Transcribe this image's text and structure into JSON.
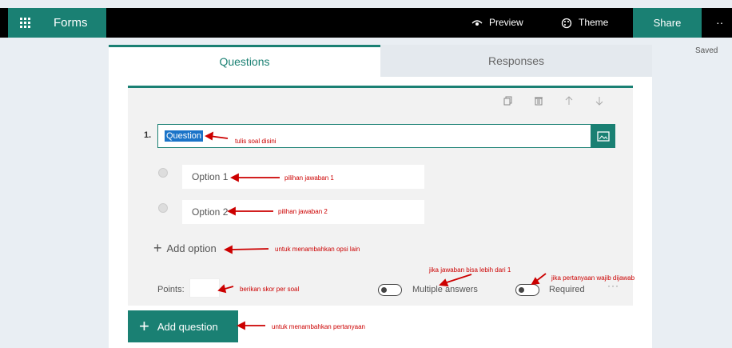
{
  "header": {
    "app_name": "Forms",
    "preview_label": "Preview",
    "theme_label": "Theme",
    "share_label": "Share",
    "more_label": "··"
  },
  "status": {
    "saved": "Saved"
  },
  "tabs": [
    {
      "label": "Questions",
      "active": true
    },
    {
      "label": "Responses",
      "active": false
    }
  ],
  "question": {
    "number": "1.",
    "text": "Question",
    "options": [
      {
        "label": "Option 1"
      },
      {
        "label": "Option 2"
      }
    ],
    "add_option_label": "Add option",
    "points_label": "Points:",
    "points_value": "",
    "multiple_answers_label": "Multiple answers",
    "required_label": "Required",
    "more_label": "···"
  },
  "add_question_label": "Add question",
  "annotations": {
    "question": "tulis soal disini",
    "option1": "pilihan jawaban 1",
    "option2": "pilihan jawaban 2",
    "add_option": "untuk menambahkan opsi lain",
    "points": "berikan skor per soal",
    "multiple": "jika jawaban bisa lebih dari 1",
    "required": "jika pertanyaan wajib dijawab",
    "add_question": "untuk menambahkan pertanyaan"
  },
  "colors": {
    "accent": "#1a8073",
    "annotation": "#cc0000"
  }
}
